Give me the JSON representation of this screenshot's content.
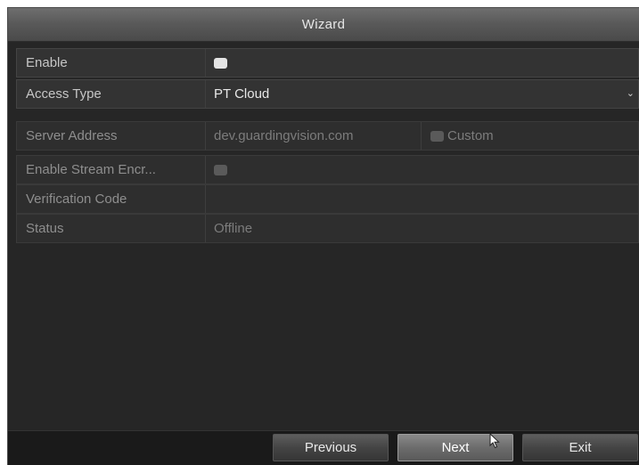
{
  "window": {
    "title": "Wizard"
  },
  "form": {
    "enable": {
      "label": "Enable",
      "checked": true
    },
    "access_type": {
      "label": "Access Type",
      "value": "PT Cloud"
    },
    "server_address": {
      "label": "Server Address",
      "value": "dev.guardingvision.com",
      "custom_label": "Custom",
      "custom_checked": false
    },
    "stream_encryption": {
      "label": "Enable Stream Encr...",
      "checked": false
    },
    "verification_code": {
      "label": "Verification Code",
      "value": ""
    },
    "status": {
      "label": "Status",
      "value": "Offline"
    }
  },
  "buttons": {
    "previous": "Previous",
    "next": "Next",
    "exit": "Exit"
  },
  "icons": {
    "dropdown": "chevron-down-icon",
    "cursor": "mouse-pointer-icon"
  },
  "colors": {
    "background": "#262626",
    "title_bar": "#5a5a5a",
    "active_text": "#e8e8e8",
    "disabled_text": "#7c7c7c"
  }
}
